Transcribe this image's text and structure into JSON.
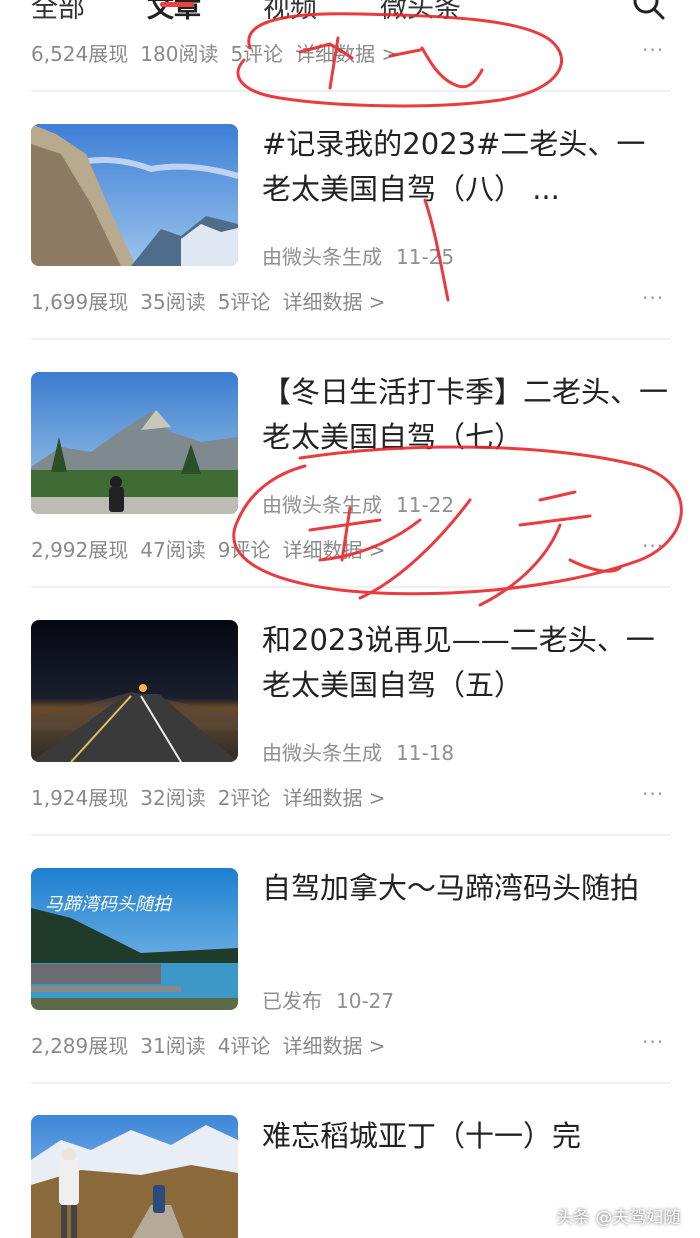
{
  "tabs": [
    {
      "label": "全部",
      "active": false
    },
    {
      "label": "文章",
      "active": true
    },
    {
      "label": "视频",
      "active": false
    },
    {
      "label": "微头条",
      "active": false
    }
  ],
  "top_stats": {
    "views": "6,524展现",
    "reads": "180阅读",
    "comments": "5评论",
    "detail": "详细数据 >"
  },
  "articles": [
    {
      "title": "#记录我的2023#二老头、一老太美国自驾（八） ...",
      "source": "由微头条生成",
      "date": "11-25",
      "views": "1,699展现",
      "reads": "35阅读",
      "comments": "5评论",
      "detail": "详细数据 >"
    },
    {
      "title": "【冬日生活打卡季】二老头、一老太美国自驾（七）",
      "source": "由微头条生成",
      "date": "11-22",
      "views": "2,992展现",
      "reads": "47阅读",
      "comments": "9评论",
      "detail": "详细数据 >"
    },
    {
      "title": "和2023说再见——二老头、一老太美国自驾（五）",
      "source": "由微头条生成",
      "date": "11-18",
      "views": "1,924展现",
      "reads": "32阅读",
      "comments": "2评论",
      "detail": "详细数据 >"
    },
    {
      "title": "自驾加拿大～马蹄湾码头随拍",
      "source": "已发布",
      "date": "10-27",
      "thumb_caption": "马蹄湾码头随拍",
      "views": "2,289展现",
      "reads": "31阅读",
      "comments": "4评论",
      "detail": "详细数据 >"
    },
    {
      "title": "难忘稻城亚丁（十一）完",
      "source": "",
      "date": ""
    }
  ],
  "more_label": "···",
  "watermark": "头条 @夫驾妇随",
  "colors": {
    "accent": "#f04142",
    "annotation": "#e8262b",
    "muted": "#8a8a8a"
  },
  "icons": {
    "search": "search-icon",
    "more": "more-dots-icon"
  }
}
